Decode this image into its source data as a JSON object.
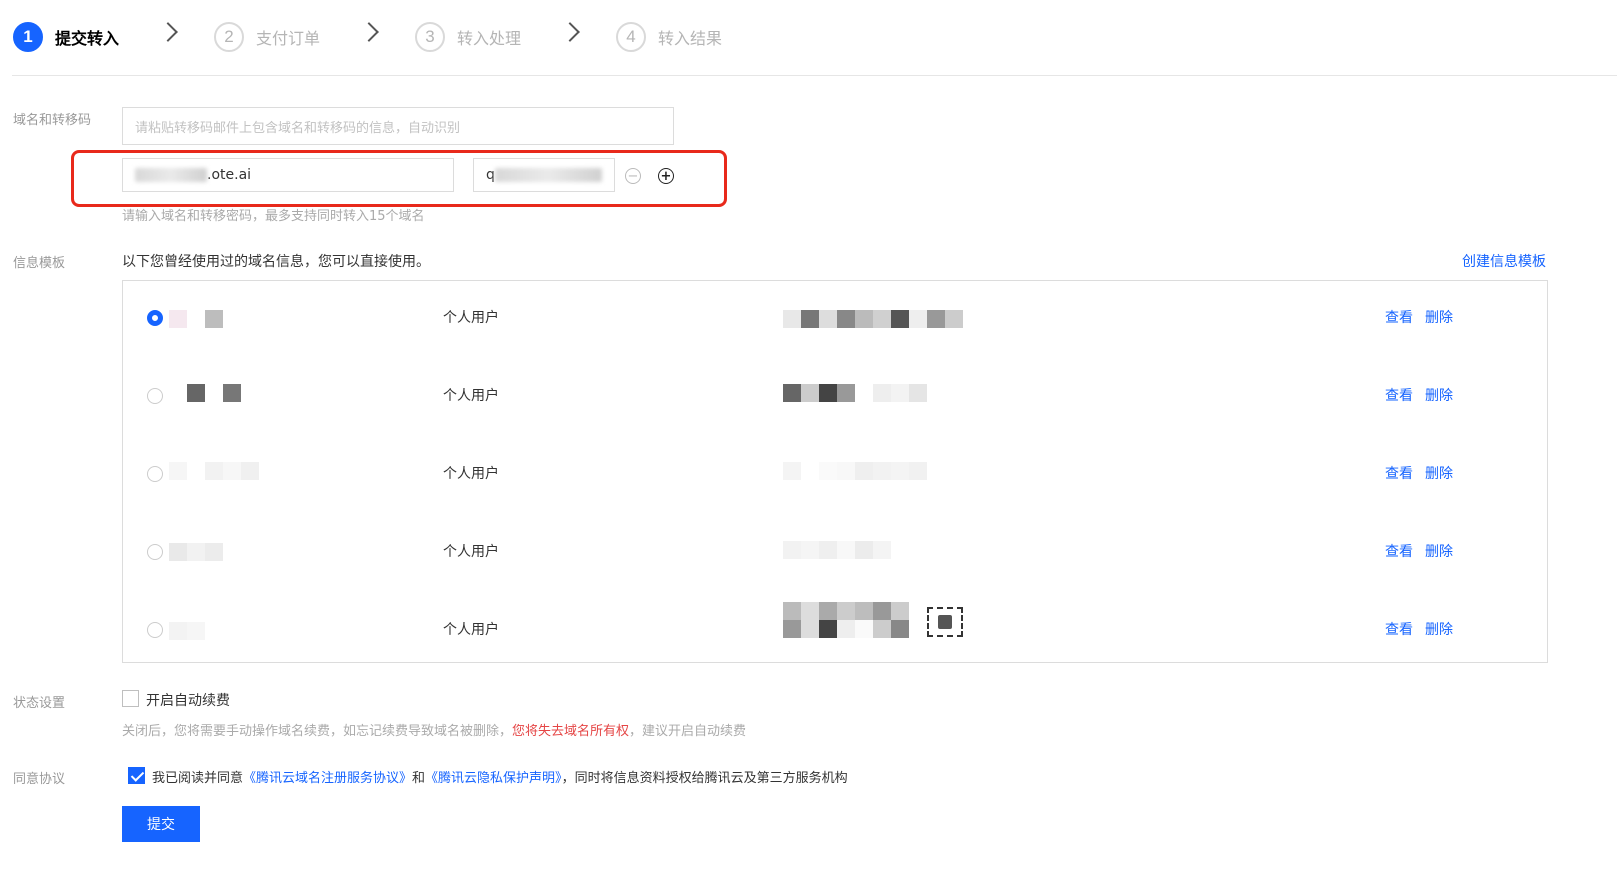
{
  "steps": [
    {
      "number": "1",
      "label": "提交转入"
    },
    {
      "number": "2",
      "label": "支付订单"
    },
    {
      "number": "3",
      "label": "转入处理"
    },
    {
      "number": "4",
      "label": "转入结果"
    }
  ],
  "domain_section": {
    "label": "域名和转移码",
    "paste_placeholder": "请粘贴转移码邮件上包含域名和转移码的信息，自动识别",
    "domain_value_suffix": ".ote.ai",
    "code_value_prefix": "q",
    "hint": "请输入域名和转移密码，最多支持同时转入15个域名"
  },
  "template_section": {
    "label": "信息模板",
    "description": "以下您曾经使用过的域名信息，您可以直接使用。",
    "create_link": "创建信息模板",
    "rows": [
      {
        "type": "个人用户",
        "view": "查看",
        "delete": "删除",
        "selected": true
      },
      {
        "type": "个人用户",
        "view": "查看",
        "delete": "删除",
        "selected": false
      },
      {
        "type": "个人用户",
        "view": "查看",
        "delete": "删除",
        "selected": false
      },
      {
        "type": "个人用户",
        "view": "查看",
        "delete": "删除",
        "selected": false
      },
      {
        "type": "个人用户",
        "view": "查看",
        "delete": "删除",
        "selected": false
      }
    ]
  },
  "status_section": {
    "label": "状态设置",
    "auto_renew_label": "开启自动续费",
    "auto_renew_checked": false,
    "note_before": "关闭后，您将需要手动操作域名续费，如忘记续费导致域名被删除，",
    "note_warning": "您将失去域名所有权",
    "note_after": "，建议开启自动续费"
  },
  "agreement_section": {
    "label": "同意协议",
    "checked": true,
    "text_1": "我已阅读并同意",
    "link_1": "《腾讯云域名注册服务协议》",
    "text_2": "和",
    "link_2": "《腾讯云隐私保护声明》",
    "text_3": "，同时将信息资料授权给腾讯云及第三方服务机构"
  },
  "submit_label": "提交",
  "colors": {
    "primary": "#1664ff",
    "warning": "#e54545",
    "highlight_border": "#e8291b"
  }
}
